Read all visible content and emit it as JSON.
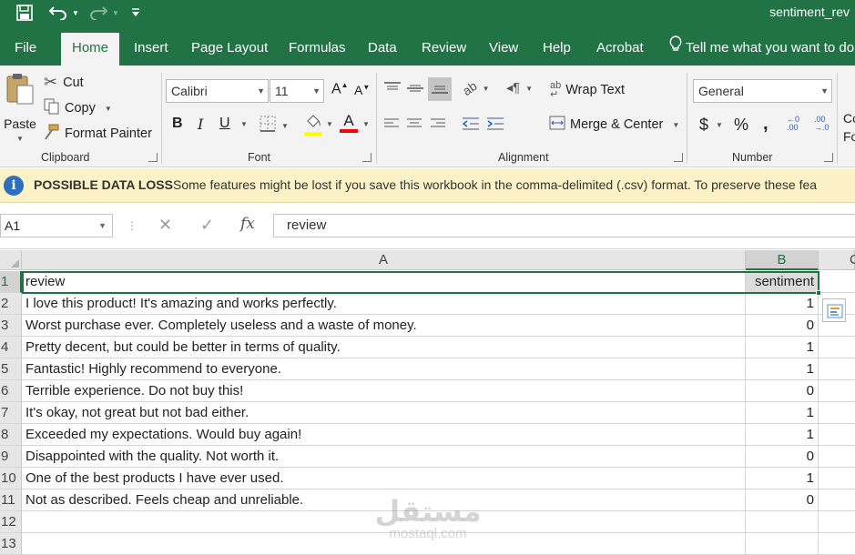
{
  "window": {
    "doc_title": "sentiment_rev"
  },
  "tabs": [
    {
      "label": "File"
    },
    {
      "label": "Home"
    },
    {
      "label": "Insert"
    },
    {
      "label": "Page Layout"
    },
    {
      "label": "Formulas"
    },
    {
      "label": "Data"
    },
    {
      "label": "Review"
    },
    {
      "label": "View"
    },
    {
      "label": "Help"
    },
    {
      "label": "Acrobat"
    }
  ],
  "tell_me": "Tell me what you want to do",
  "ribbon": {
    "clipboard": {
      "paste": "Paste",
      "cut": "Cut",
      "copy": "Copy",
      "format_painter": "Format Painter",
      "label": "Clipboard"
    },
    "font": {
      "name": "Calibri",
      "size": "11",
      "label": "Font",
      "bold": "B",
      "italic": "I",
      "underline": "U"
    },
    "alignment": {
      "wrap_text": "Wrap Text",
      "merge_center": "Merge & Center",
      "label": "Alignment"
    },
    "number": {
      "format": "General",
      "currency": "$",
      "percent": "%",
      "comma": ",",
      "label": "Number"
    },
    "styles_partial": [
      "Co",
      "Fo"
    ]
  },
  "infobar": {
    "title": "POSSIBLE DATA LOSS",
    "message": "Some features might be lost if you save this workbook in the comma-delimited (.csv) format. To preserve these fea"
  },
  "formula_bar": {
    "name_box": "A1",
    "fx": "fx",
    "content": "review"
  },
  "sheet": {
    "columns": [
      "A",
      "B",
      "C"
    ],
    "rows": [
      {
        "num": "1",
        "a": "review",
        "b": "sentiment"
      },
      {
        "num": "2",
        "a": "I love this product! It's amazing and works perfectly.",
        "b": "1"
      },
      {
        "num": "3",
        "a": "Worst purchase ever. Completely useless and a waste of money.",
        "b": "0"
      },
      {
        "num": "4",
        "a": "Pretty decent, but could be better in terms of quality.",
        "b": "1"
      },
      {
        "num": "5",
        "a": "Fantastic! Highly recommend to everyone.",
        "b": "1"
      },
      {
        "num": "6",
        "a": "Terrible experience. Do not buy this!",
        "b": "0"
      },
      {
        "num": "7",
        "a": "It's okay, not great but not bad either.",
        "b": "1"
      },
      {
        "num": "8",
        "a": "Exceeded my expectations. Would buy again!",
        "b": "1"
      },
      {
        "num": "9",
        "a": "Disappointed with the quality. Not worth it.",
        "b": "0"
      },
      {
        "num": "10",
        "a": "One of the best products I have ever used.",
        "b": "1"
      },
      {
        "num": "11",
        "a": "Not as described. Feels cheap and unreliable.",
        "b": "0"
      },
      {
        "num": "12",
        "a": "",
        "b": ""
      },
      {
        "num": "13",
        "a": "",
        "b": ""
      }
    ]
  },
  "watermark": {
    "logo": "مستقل",
    "text": "mostaql.com"
  },
  "colors": {
    "excel_green": "#217346",
    "info_bg": "#fdf2c7",
    "ribbon_bg": "#f3f3f3"
  }
}
